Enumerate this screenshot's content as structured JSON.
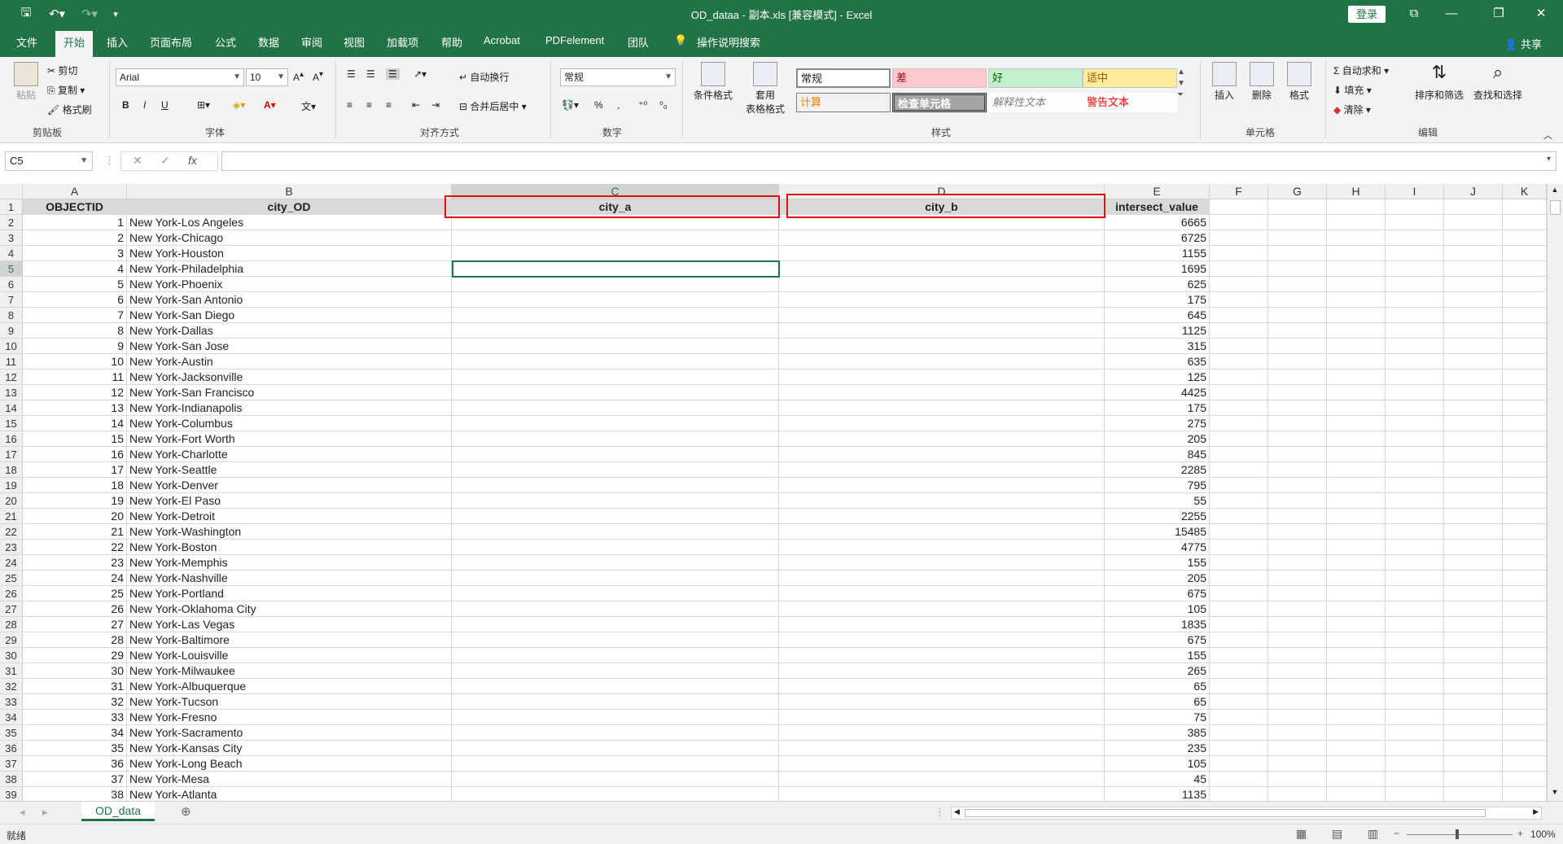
{
  "window": {
    "title": "OD_dataa - 副本.xls  [兼容模式]  -  Excel",
    "login_label": "登录",
    "share_label": "共享"
  },
  "menu": {
    "tabs": [
      "文件",
      "开始",
      "插入",
      "页面布局",
      "公式",
      "数据",
      "审阅",
      "视图",
      "加载项",
      "帮助",
      "Acrobat",
      "PDFelement",
      "团队"
    ],
    "tell_me": "操作说明搜索"
  },
  "ribbon": {
    "clipboard": {
      "paste": "粘贴",
      "cut": "剪切",
      "copy": "复制",
      "format_painter": "格式刷",
      "label": "剪贴板"
    },
    "font": {
      "name": "Arial",
      "size": "10",
      "label": "字体",
      "bold": "B",
      "italic": "I",
      "underline": "U"
    },
    "alignment": {
      "wrap": "自动换行",
      "merge": "合并后居中",
      "label": "对齐方式"
    },
    "number": {
      "format": "常规",
      "percent": "%",
      "comma": ",",
      "label": "数字"
    },
    "styles": {
      "conditional": "条件格式",
      "table_format_1": "套用",
      "table_format_2": "表格格式",
      "normal": "常规",
      "bad": "差",
      "good": "好",
      "neutral": "适中",
      "calc": "计算",
      "check": "检查单元格",
      "explanatory": "解释性文本",
      "warning": "警告文本",
      "label": "样式"
    },
    "cells": {
      "insert": "插入",
      "delete": "删除",
      "format": "格式",
      "label": "单元格"
    },
    "editing": {
      "autosum": "自动求和",
      "fill": "填充",
      "clear": "清除",
      "sort_filter": "排序和筛选",
      "find_select": "查找和选择",
      "label": "编辑"
    }
  },
  "formula_bar": {
    "name_box": "C5",
    "fx": "fx",
    "formula": ""
  },
  "grid": {
    "columns": [
      "A",
      "B",
      "C",
      "D",
      "E",
      "F",
      "G",
      "H",
      "I",
      "J",
      "K"
    ],
    "header_row": {
      "A": "OBJECTID",
      "B": "city_OD",
      "C": "city_a",
      "D": "city_b",
      "E": "intersect_value"
    },
    "rows": [
      {
        "id": "1",
        "od": "New York-Los Angeles",
        "value": "6665"
      },
      {
        "id": "2",
        "od": "New York-Chicago",
        "value": "6725"
      },
      {
        "id": "3",
        "od": "New York-Houston",
        "value": "1155"
      },
      {
        "id": "4",
        "od": "New York-Philadelphia",
        "value": "1695"
      },
      {
        "id": "5",
        "od": "New York-Phoenix",
        "value": "625"
      },
      {
        "id": "6",
        "od": "New York-San Antonio",
        "value": "175"
      },
      {
        "id": "7",
        "od": "New York-San Diego",
        "value": "645"
      },
      {
        "id": "8",
        "od": "New York-Dallas",
        "value": "1125"
      },
      {
        "id": "9",
        "od": "New York-San Jose",
        "value": "315"
      },
      {
        "id": "10",
        "od": "New York-Austin",
        "value": "635"
      },
      {
        "id": "11",
        "od": "New York-Jacksonville",
        "value": "125"
      },
      {
        "id": "12",
        "od": "New York-San Francisco",
        "value": "4425"
      },
      {
        "id": "13",
        "od": "New York-Indianapolis",
        "value": "175"
      },
      {
        "id": "14",
        "od": "New York-Columbus",
        "value": "275"
      },
      {
        "id": "15",
        "od": "New York-Fort Worth",
        "value": "205"
      },
      {
        "id": "16",
        "od": "New York-Charlotte",
        "value": "845"
      },
      {
        "id": "17",
        "od": "New York-Seattle",
        "value": "2285"
      },
      {
        "id": "18",
        "od": "New York-Denver",
        "value": "795"
      },
      {
        "id": "19",
        "od": "New York-El Paso",
        "value": "55"
      },
      {
        "id": "20",
        "od": "New York-Detroit",
        "value": "2255"
      },
      {
        "id": "21",
        "od": "New York-Washington",
        "value": "15485"
      },
      {
        "id": "22",
        "od": "New York-Boston",
        "value": "4775"
      },
      {
        "id": "23",
        "od": "New York-Memphis",
        "value": "155"
      },
      {
        "id": "24",
        "od": "New York-Nashville",
        "value": "205"
      },
      {
        "id": "25",
        "od": "New York-Portland",
        "value": "675"
      },
      {
        "id": "26",
        "od": "New York-Oklahoma City",
        "value": "105"
      },
      {
        "id": "27",
        "od": "New York-Las Vegas",
        "value": "1835"
      },
      {
        "id": "28",
        "od": "New York-Baltimore",
        "value": "675"
      },
      {
        "id": "29",
        "od": "New York-Louisville",
        "value": "155"
      },
      {
        "id": "30",
        "od": "New York-Milwaukee",
        "value": "265"
      },
      {
        "id": "31",
        "od": "New York-Albuquerque",
        "value": "65"
      },
      {
        "id": "32",
        "od": "New York-Tucson",
        "value": "65"
      },
      {
        "id": "33",
        "od": "New York-Fresno",
        "value": "75"
      },
      {
        "id": "34",
        "od": "New York-Sacramento",
        "value": "385"
      },
      {
        "id": "35",
        "od": "New York-Kansas City",
        "value": "235"
      },
      {
        "id": "36",
        "od": "New York-Long Beach",
        "value": "105"
      },
      {
        "id": "37",
        "od": "New York-Mesa",
        "value": "45"
      },
      {
        "id": "38",
        "od": "New York-Atlanta",
        "value": "1135"
      }
    ]
  },
  "sheets": {
    "active": "OD_data"
  },
  "status": {
    "ready": "就绪",
    "zoom": "100%"
  },
  "colors": {
    "accent": "#217346",
    "highlight_box": "#e01010"
  }
}
